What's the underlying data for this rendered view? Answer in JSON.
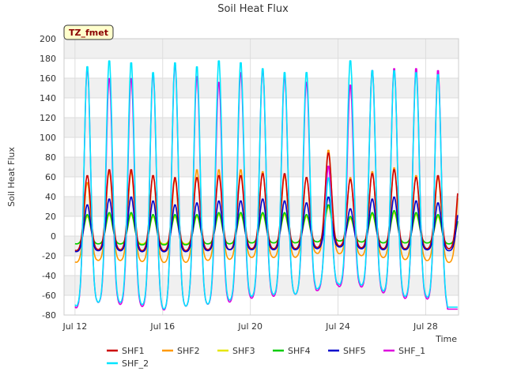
{
  "chart_data": {
    "type": "line",
    "title": "Soil Heat Flux",
    "xlabel": "Time",
    "ylabel": "Soil Heat Flux",
    "badge": "TZ_fmet",
    "x_start": "Jul 11 12:00",
    "x_end": "Jul 29 12:00",
    "ylim": [
      -80,
      200
    ],
    "yticks": [
      -80,
      -60,
      -40,
      -20,
      0,
      20,
      40,
      60,
      80,
      100,
      120,
      140,
      160,
      180,
      200
    ],
    "xticks": [
      {
        "label": "Jul 12",
        "date": "Jul 12"
      },
      {
        "label": "Jul 16",
        "date": "Jul 16"
      },
      {
        "label": "Jul 20",
        "date": "Jul 20"
      },
      {
        "label": "Jul 24",
        "date": "Jul 24"
      },
      {
        "label": "Jul 28",
        "date": "Jul 28"
      }
    ],
    "grid": true,
    "legend_placement": "bottom",
    "days": [
      "Jul 12",
      "Jul 13",
      "Jul 14",
      "Jul 15",
      "Jul 16",
      "Jul 17",
      "Jul 18",
      "Jul 19",
      "Jul 20",
      "Jul 21",
      "Jul 22",
      "Jul 23",
      "Jul 24",
      "Jul 25",
      "Jul 26",
      "Jul 27",
      "Jul 28",
      "Jul 29"
    ],
    "series": [
      {
        "name": "SHF1",
        "color": "#cc0000",
        "daily_max": [
          62,
          68,
          68,
          62,
          60,
          60,
          62,
          62,
          64,
          64,
          60,
          85,
          58,
          64,
          68,
          60,
          62,
          60
        ],
        "daily_min": [
          -15,
          -14,
          -14,
          -15,
          -15,
          -15,
          -14,
          -14,
          -13,
          -13,
          -13,
          -12,
          -10,
          -12,
          -13,
          -13,
          -13,
          -13
        ]
      },
      {
        "name": "SHF2",
        "color": "#ff9900",
        "daily_max": [
          55,
          66,
          66,
          62,
          58,
          68,
          68,
          68,
          66,
          62,
          60,
          88,
          60,
          66,
          70,
          62,
          60,
          58
        ],
        "daily_min": [
          -27,
          -25,
          -25,
          -26,
          -27,
          -27,
          -25,
          -24,
          -22,
          -22,
          -22,
          -18,
          -18,
          -20,
          -22,
          -24,
          -25,
          -27
        ]
      },
      {
        "name": "SHF3",
        "color": "#e6e600",
        "daily_max": [
          20,
          22,
          22,
          20,
          20,
          20,
          22,
          22,
          22,
          22,
          20,
          30,
          18,
          22,
          24,
          22,
          20,
          20
        ],
        "daily_min": [
          -8,
          -8,
          -8,
          -8,
          -8,
          -8,
          -8,
          -8,
          -7,
          -7,
          -7,
          -6,
          -5,
          -6,
          -7,
          -7,
          -7,
          -8
        ]
      },
      {
        "name": "SHF4",
        "color": "#00cc00",
        "daily_max": [
          22,
          24,
          24,
          22,
          22,
          22,
          24,
          24,
          24,
          24,
          22,
          32,
          20,
          24,
          26,
          24,
          22,
          22
        ],
        "daily_min": [
          -8,
          -8,
          -8,
          -9,
          -9,
          -9,
          -8,
          -8,
          -7,
          -7,
          -7,
          -6,
          -5,
          -6,
          -7,
          -7,
          -7,
          -8
        ]
      },
      {
        "name": "SHF5",
        "color": "#0000cc",
        "daily_max": [
          32,
          38,
          40,
          36,
          32,
          34,
          36,
          36,
          38,
          36,
          34,
          40,
          28,
          38,
          40,
          36,
          34,
          32
        ],
        "daily_min": [
          -16,
          -15,
          -15,
          -16,
          -16,
          -16,
          -15,
          -14,
          -14,
          -14,
          -14,
          -13,
          -11,
          -13,
          -14,
          -14,
          -14,
          -15
        ]
      },
      {
        "name": "SHF_1",
        "color": "#dd00dd",
        "daily_max": [
          172,
          162,
          162,
          166,
          176,
          164,
          158,
          168,
          170,
          164,
          158,
          72,
          155,
          170,
          172,
          172,
          170,
          0
        ],
        "daily_min": [
          -74,
          -68,
          -70,
          -72,
          -76,
          -72,
          -70,
          -68,
          -64,
          -62,
          -60,
          -56,
          -52,
          -52,
          -58,
          -64,
          -64,
          -74
        ]
      },
      {
        "name": "SHF_2",
        "color": "#00e5ff",
        "daily_max": [
          174,
          180,
          178,
          168,
          178,
          174,
          180,
          178,
          172,
          168,
          168,
          60,
          180,
          170,
          170,
          168,
          166,
          0
        ],
        "daily_min": [
          -72,
          -68,
          -68,
          -70,
          -75,
          -72,
          -70,
          -66,
          -62,
          -60,
          -60,
          -54,
          -50,
          -50,
          -56,
          -62,
          -62,
          -72
        ]
      }
    ]
  }
}
